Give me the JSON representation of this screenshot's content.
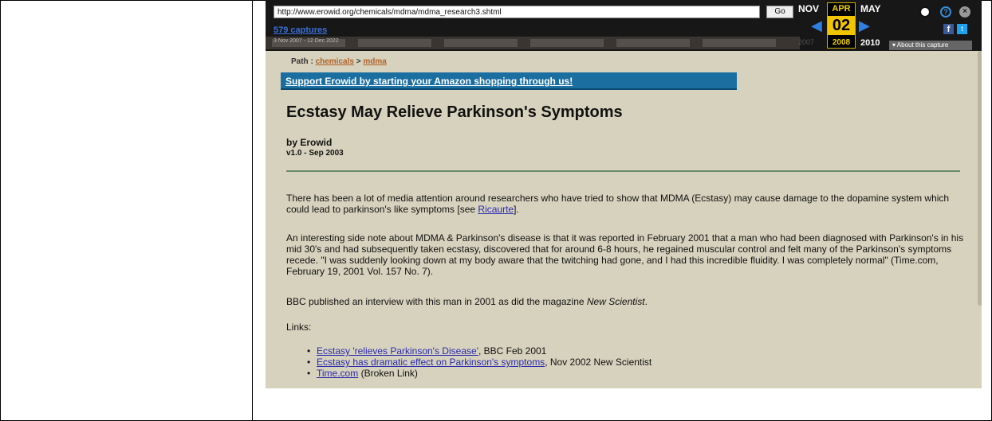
{
  "toolbar": {
    "url": "http://www.erowid.org/chemicals/mdma/mdma_research3.shtml",
    "go_label": "Go",
    "captures": "579 captures",
    "date_range": "3 Nov 2007 - 12 Dec 2022",
    "prev_month": "NOV",
    "current_month": "APR",
    "current_day": "02",
    "current_year": "2008",
    "next_month": "MAY",
    "prev_year": "2007",
    "next_year": "2010",
    "about_label": "▾ About this capture"
  },
  "page": {
    "path_label": "Path :",
    "crumbs": [
      "chemicals",
      "mdma"
    ],
    "crumb_sep": ">",
    "amazon_banner": "Support Erowid by starting your Amazon shopping through us!",
    "title": "Ecstasy May Relieve Parkinson's Symptoms",
    "byline": "by Erowid",
    "version": "v1.0 - Sep 2003",
    "p1_before": "There has been a lot of media attention around researchers who have tried to show that MDMA (Ecstasy) may cause damage to the dopamine system which could lead to parkinson's like symptoms [see ",
    "p1_link": "Ricaurte",
    "p1_after": "].",
    "p2": "An interesting side note about MDMA & Parkinson's disease is that it was reported in February 2001 that a man who had been diagnosed with Parkinson's in his mid 30's and had subsequently taken ecstasy, discovered that for around 6-8 hours, he regained muscular control and felt many of the Parkinson's symptoms recede. \"I was suddenly looking down at my body aware that the twitching had gone, and I had this incredible fluidity. I was completely normal\" (Time.com, February 19, 2001 Vol. 157 No. 7).",
    "p3_before": "BBC published an interview with this man in 2001 as did the magazine ",
    "p3_italic": "New Scientist",
    "p3_after": ".",
    "links_label": "Links:",
    "links": [
      {
        "text": "Ecstasy 'relieves Parkinson's Disease'",
        "suffix": ", BBC Feb 2001"
      },
      {
        "text": "Ecstasy has dramatic effect on Parkinson's symptoms",
        "suffix": ", Nov 2002 New Scientist"
      },
      {
        "text": "Time.com",
        "suffix": " (Broken Link)"
      }
    ]
  }
}
